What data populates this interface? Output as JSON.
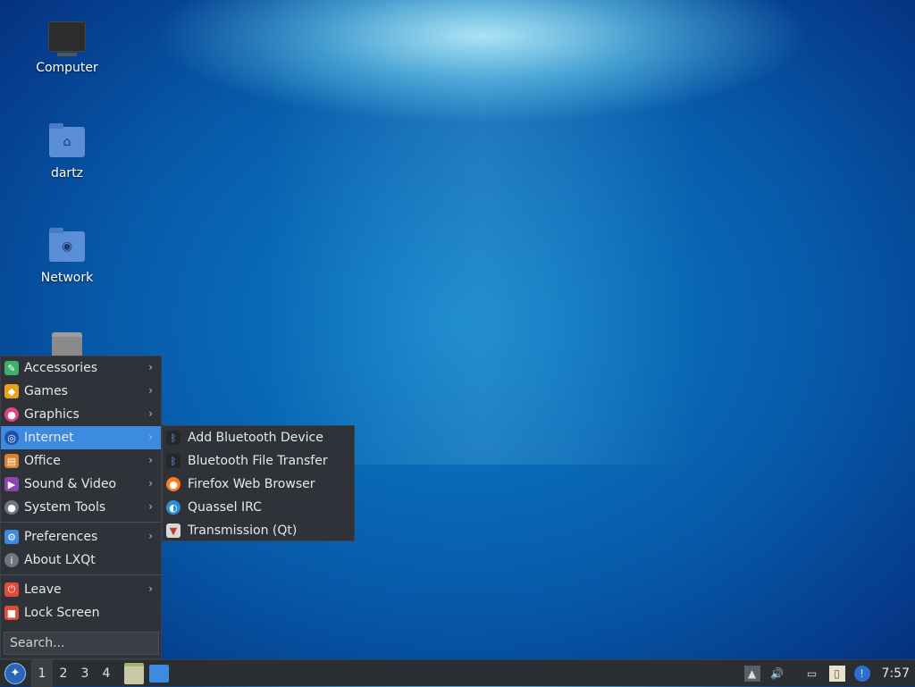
{
  "desktop": {
    "icons": [
      {
        "label": "Computer",
        "icon": "computer-icon"
      },
      {
        "label": "dartz",
        "icon": "home-folder-icon"
      },
      {
        "label": "Network",
        "icon": "network-folder-icon"
      },
      {
        "label": "",
        "icon": "trash-icon"
      }
    ]
  },
  "menu": {
    "categories": [
      {
        "label": "Accessories",
        "icon": "accessories-icon",
        "color": "#3fae6a"
      },
      {
        "label": "Games",
        "icon": "games-icon",
        "color": "#e8a020"
      },
      {
        "label": "Graphics",
        "icon": "graphics-icon",
        "color": "#e0457b"
      },
      {
        "label": "Internet",
        "icon": "internet-icon",
        "color": "#3aa0ff"
      },
      {
        "label": "Office",
        "icon": "office-icon",
        "color": "#d9822b"
      },
      {
        "label": "Sound & Video",
        "icon": "sound-video-icon",
        "color": "#8e44ad"
      },
      {
        "label": "System Tools",
        "icon": "system-tools-icon",
        "color": "#6f7680"
      }
    ],
    "preferences": {
      "label": "Preferences",
      "icon": "preferences-icon",
      "color": "#3d8be0"
    },
    "about": {
      "label": "About LXQt",
      "icon": "info-icon",
      "color": "#6f7680"
    },
    "leave": {
      "label": "Leave",
      "icon": "power-icon",
      "color": "#e04b3a"
    },
    "lock": {
      "label": "Lock Screen",
      "icon": "lock-icon",
      "color": "#e04b3a"
    },
    "search_placeholder": "Search..."
  },
  "submenu": {
    "items": [
      {
        "label": "Add Bluetooth Device",
        "icon": "bluetooth-icon"
      },
      {
        "label": "Bluetooth File Transfer",
        "icon": "bluetooth-icon"
      },
      {
        "label": "Firefox Web Browser",
        "icon": "firefox-icon"
      },
      {
        "label": "Quassel IRC",
        "icon": "quassel-icon"
      },
      {
        "label": "Transmission (Qt)",
        "icon": "transmission-icon"
      }
    ]
  },
  "taskbar": {
    "workspaces": [
      "1",
      "2",
      "3",
      "4"
    ],
    "current_workspace": "1",
    "clock": "7:57"
  }
}
